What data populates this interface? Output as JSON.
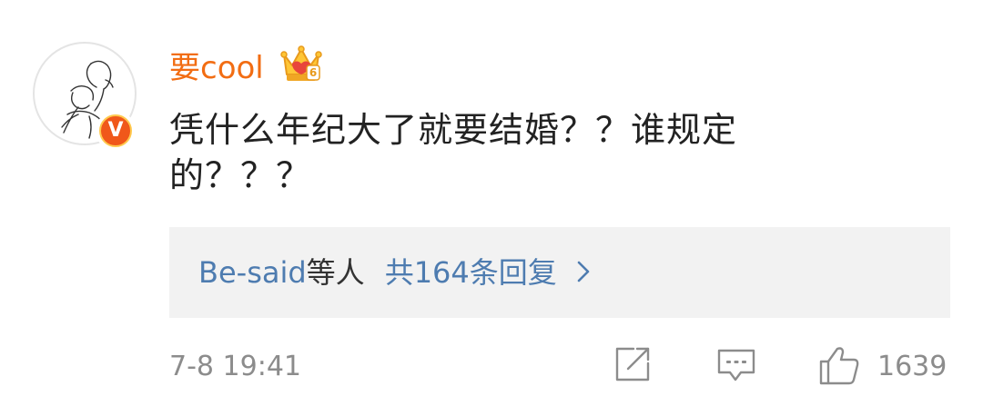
{
  "comment": {
    "username": "要cool",
    "text_lines": [
      "凭什么年纪大了就要结婚？？谁规定",
      "的？？？"
    ],
    "timestamp": "7-8 19:41",
    "like_count": "1639"
  },
  "replies": {
    "names": "Be-said",
    "names_suffix": "等人",
    "count_label": "共164条回复"
  },
  "badges": {
    "verified_letter": "V",
    "verified_color": "#f0581a",
    "membership_icon": "crown-icon",
    "membership_level": "6"
  },
  "colors": {
    "username": "#f26d13",
    "link": "#4e7cb0",
    "meta": "#8c8c8c",
    "reply_bg": "#f2f2f2"
  }
}
